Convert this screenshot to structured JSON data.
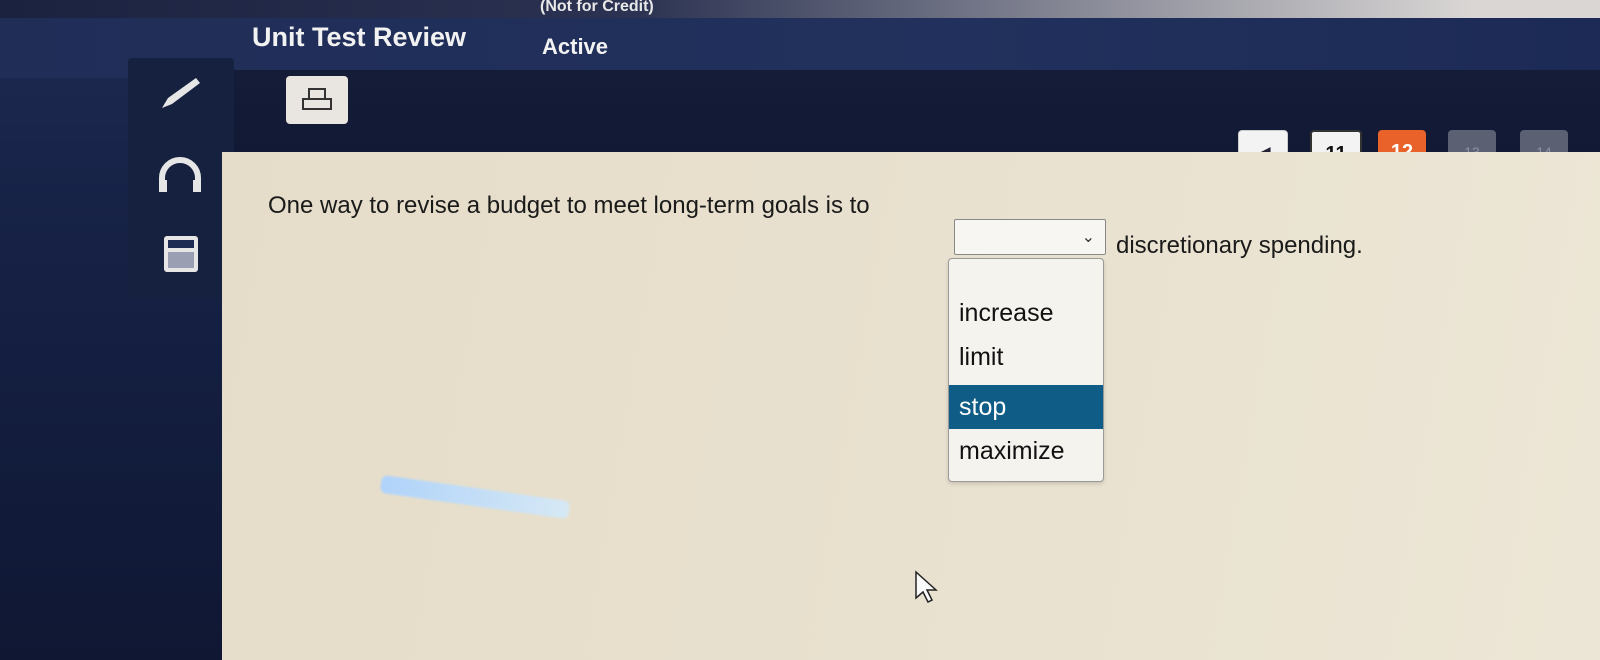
{
  "banner": {
    "text": "(Not for Credit)"
  },
  "header": {
    "title": "Unit Test Review",
    "status": "Active"
  },
  "toolbar": {
    "icons": [
      "pencil-icon",
      "headphones-icon",
      "calculator-icon"
    ]
  },
  "print": {
    "icon": "print-icon"
  },
  "pagination": {
    "prev": "◀",
    "items": [
      "11",
      "12",
      "13",
      "14"
    ],
    "current": "12"
  },
  "question": {
    "before": "One way to revise a budget to meet long-term goals is to",
    "after": "discretionary spending.",
    "selected": ""
  },
  "dropdown": {
    "options": [
      "increase",
      "limit",
      "stop",
      "maximize"
    ],
    "highlighted": "stop"
  }
}
